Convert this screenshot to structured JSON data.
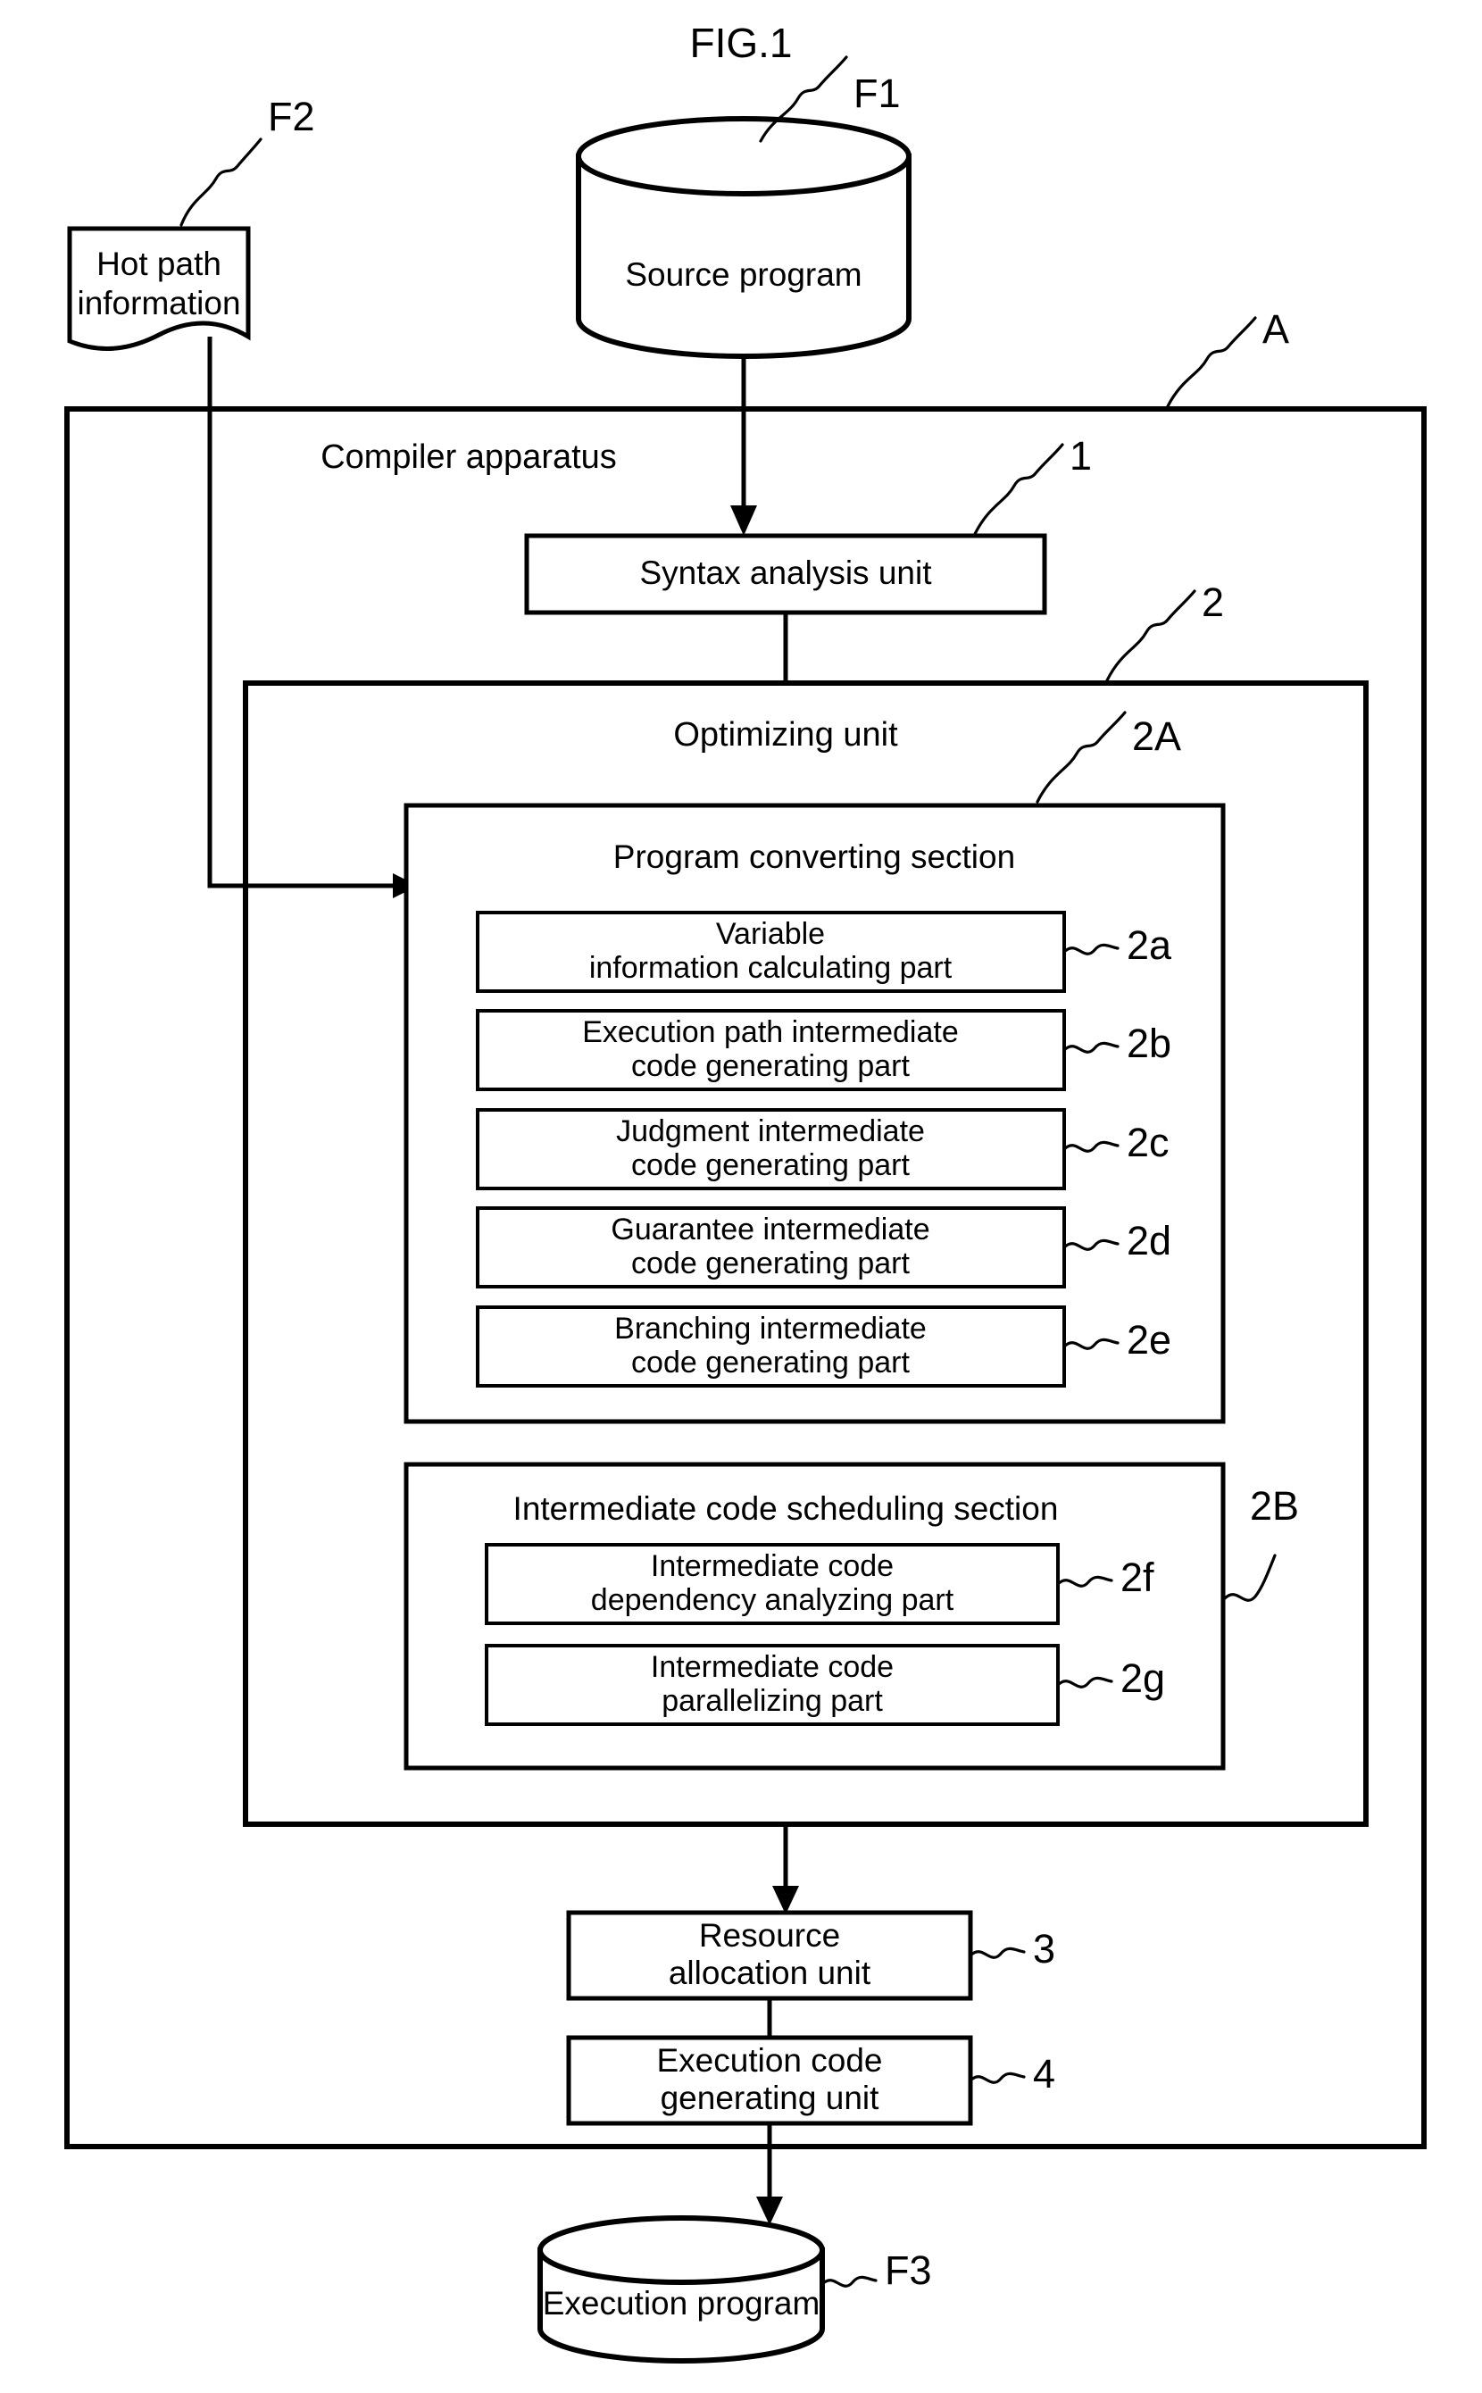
{
  "figure": {
    "title": "FIG.1"
  },
  "inputs": {
    "hot_path": {
      "label_line1": "Hot path",
      "label_line2": "information",
      "ref": "F2"
    },
    "source_program": {
      "label": "Source program",
      "ref": "F1"
    }
  },
  "apparatus": {
    "title": "Compiler apparatus",
    "ref": "A",
    "syntax_analysis": {
      "label": "Syntax analysis unit",
      "ref": "1"
    },
    "optimizing_unit": {
      "title": "Optimizing unit",
      "ref": "2",
      "program_converting_section": {
        "title": "Program converting section",
        "ref": "2A",
        "parts": [
          {
            "line1": "Variable",
            "line2": "information calculating part",
            "ref": "2a"
          },
          {
            "line1": "Execution path intermediate",
            "line2": "code generating part",
            "ref": "2b"
          },
          {
            "line1": "Judgment intermediate",
            "line2": "code generating part",
            "ref": "2c"
          },
          {
            "line1": "Guarantee intermediate",
            "line2": "code generating part",
            "ref": "2d"
          },
          {
            "line1": "Branching intermediate",
            "line2": "code generating part",
            "ref": "2e"
          }
        ]
      },
      "intermediate_code_scheduling_section": {
        "title": "Intermediate code scheduling section",
        "ref": "2B",
        "parts": [
          {
            "line1": "Intermediate code",
            "line2": "dependency analyzing part",
            "ref": "2f"
          },
          {
            "line1": "Intermediate code",
            "line2": "parallelizing part",
            "ref": "2g"
          }
        ]
      }
    },
    "resource_allocation": {
      "line1": "Resource",
      "line2": "allocation unit",
      "ref": "3"
    },
    "execution_code_generating": {
      "line1": "Execution code",
      "line2": "generating unit",
      "ref": "4"
    }
  },
  "output": {
    "execution_program": {
      "label": "Execution program",
      "ref": "F3"
    }
  },
  "colors": {
    "stroke": "#000000",
    "background": "#ffffff"
  }
}
